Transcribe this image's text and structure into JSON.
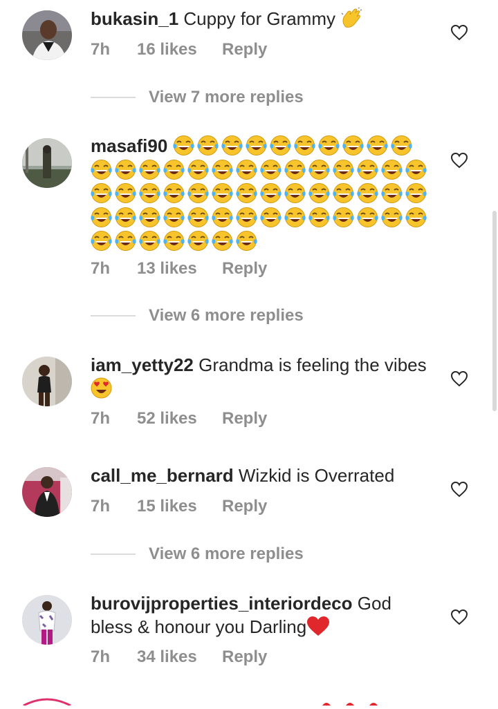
{
  "comments": [
    {
      "username": "bukasin_1",
      "text": " Cuppy for Grammy ",
      "emoji": "clapping-hands",
      "time": "7h",
      "likes": "16 likes",
      "reply": "Reply",
      "view_more": "View 7 more replies"
    },
    {
      "username": "masafi90",
      "text": "",
      "emoji": "tears-of-joy",
      "emoji_count": 59,
      "time": "7h",
      "likes": "13 likes",
      "reply": "Reply",
      "view_more": "View 6 more replies"
    },
    {
      "username": "iam_yetty22",
      "text": " Grandma is feeling the vibes",
      "emoji": "heart-eyes",
      "time": "7h",
      "likes": "52 likes",
      "reply": "Reply"
    },
    {
      "username": "call_me_bernard",
      "text": " Wizkid is Overrated",
      "time": "7h",
      "likes": "15 likes",
      "reply": "Reply",
      "view_more": "View 6 more replies"
    },
    {
      "username": "burovijproperties_interiordeco",
      "text": " God bless & honour you Darling",
      "emoji": "red-heart",
      "time": "7h",
      "likes": "34 likes",
      "reply": "Reply"
    }
  ],
  "colors": {
    "text": "#262626",
    "meta": "#8e8e8e",
    "divider": "#dbdbdb",
    "red_heart": "#e0282c",
    "emoji_yellow": "#f7c52b"
  },
  "icons": {
    "like": "heart-outline-icon"
  }
}
